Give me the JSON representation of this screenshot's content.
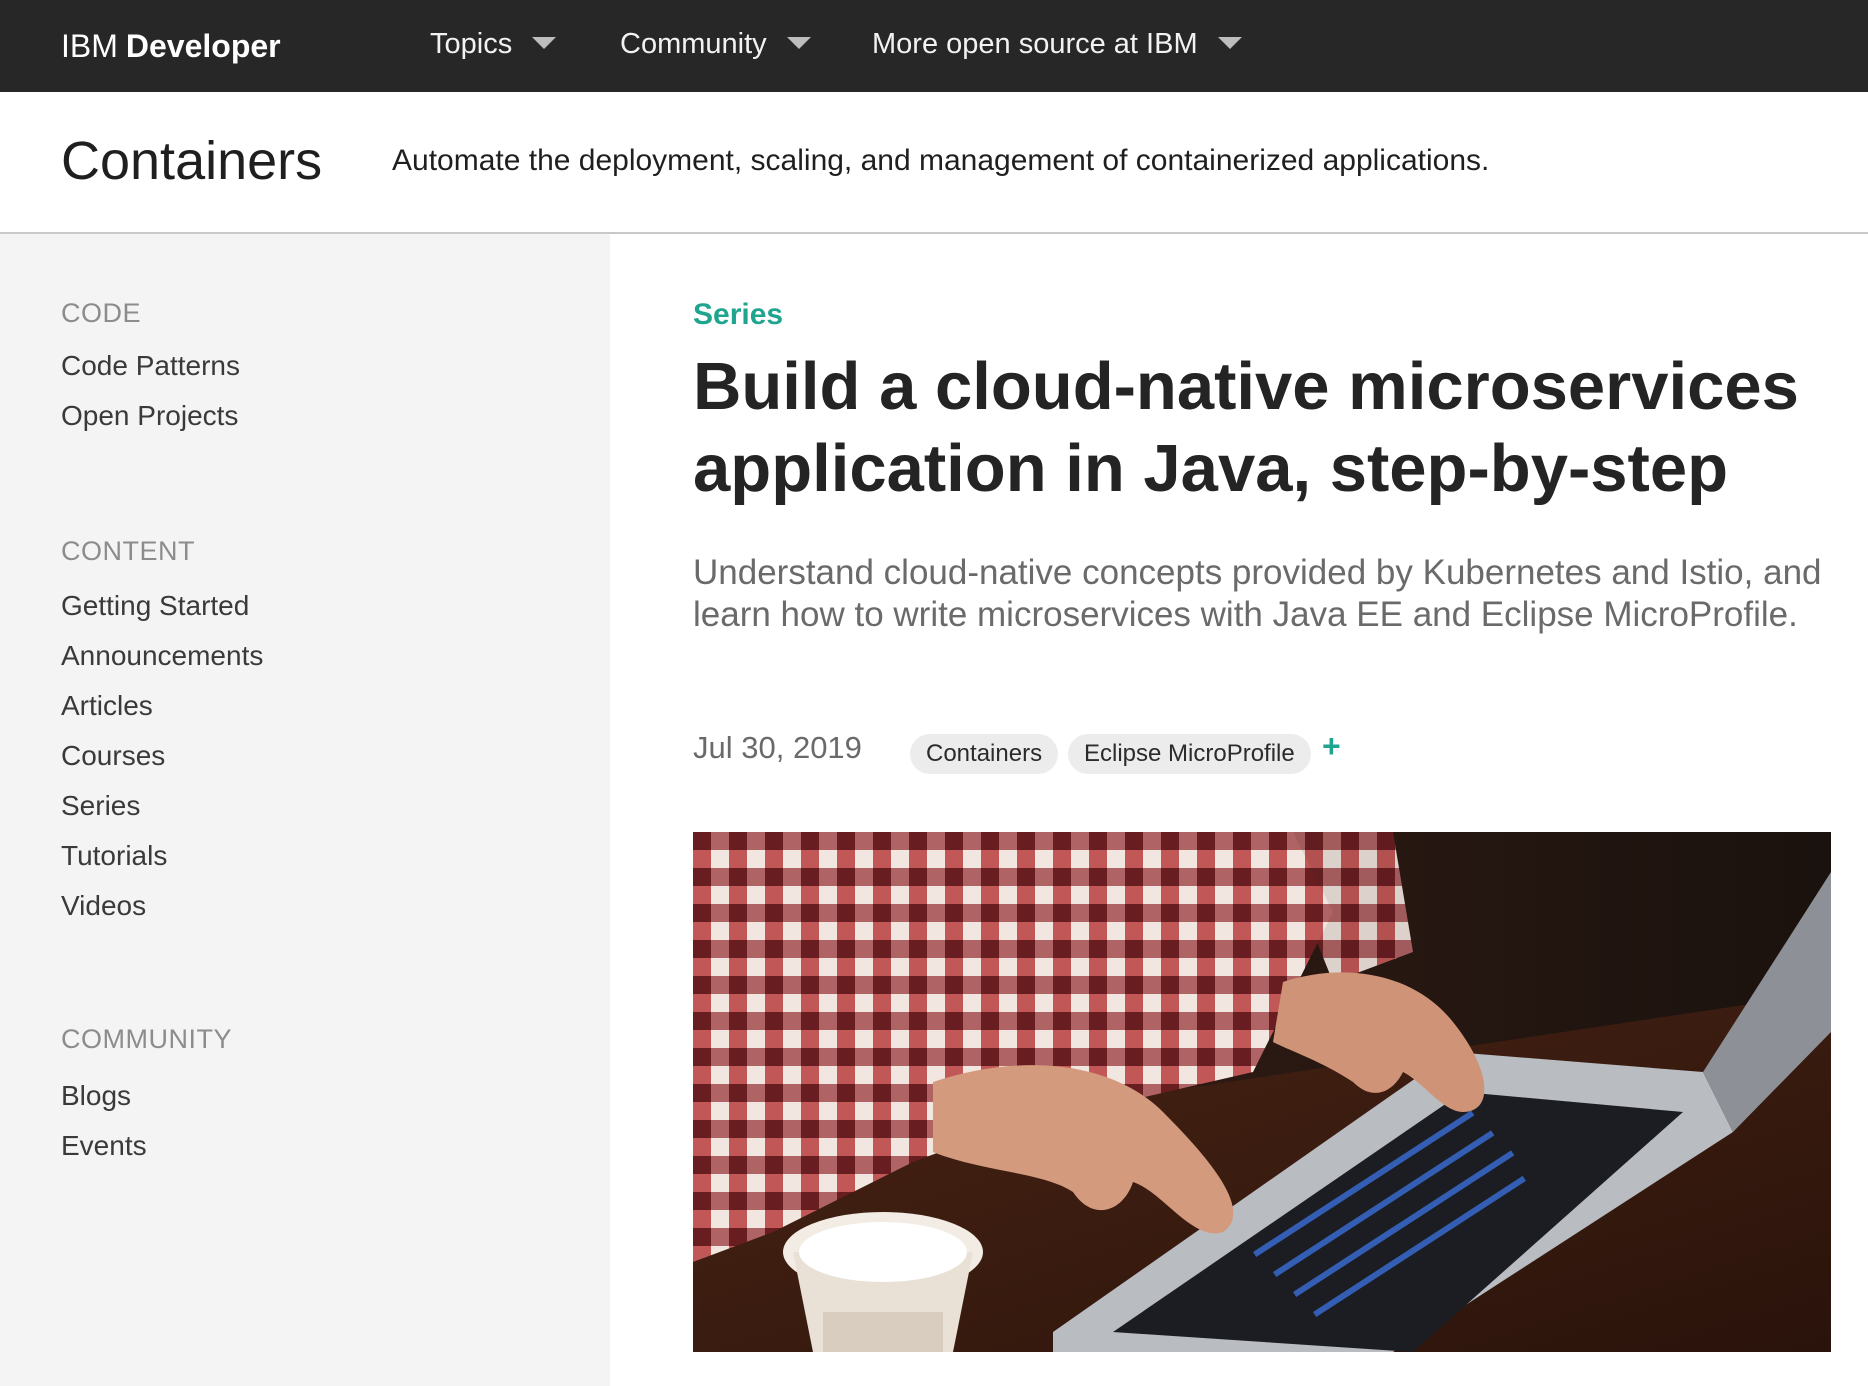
{
  "nav": {
    "brand_prefix": "IBM",
    "brand_name": "Developer",
    "items": [
      {
        "label": "Topics"
      },
      {
        "label": "Community"
      },
      {
        "label": "More open source at IBM"
      }
    ]
  },
  "topic": {
    "title": "Containers",
    "description": "Automate the deployment, scaling, and management of containerized applications."
  },
  "sidebar": {
    "sections": [
      {
        "heading": "CODE",
        "links": [
          "Code Patterns",
          "Open Projects"
        ]
      },
      {
        "heading": "CONTENT",
        "links": [
          "Getting Started",
          "Announcements",
          "Articles",
          "Courses",
          "Series",
          "Tutorials",
          "Videos"
        ]
      },
      {
        "heading": "COMMUNITY",
        "links": [
          "Blogs",
          "Events"
        ]
      }
    ]
  },
  "article": {
    "type_label": "Series",
    "title": "Build a cloud-native microservices application in Java, step-by-step",
    "summary": "Understand cloud-native concepts provided by Kubernetes and Istio, and learn how to write microservices with Java EE and Eclipse MicroProfile.",
    "date": "Jul 30, 2019",
    "tags": [
      "Containers",
      "Eclipse MicroProfile"
    ],
    "more_tags_symbol": "+"
  },
  "icons": {
    "nav_caret": "chevron-down-icon",
    "add_tag": "plus-icon"
  },
  "colors": {
    "nav_background": "#272727",
    "accent_teal": "#1fa48f",
    "sidebar_background": "#f4f4f4"
  }
}
